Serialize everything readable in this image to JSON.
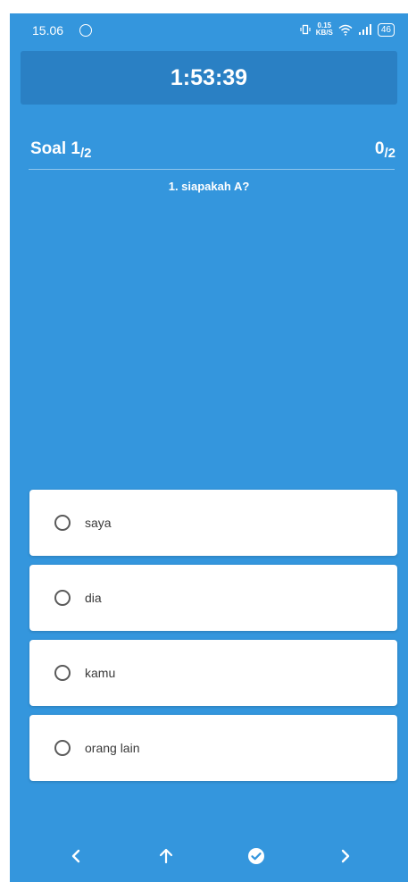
{
  "status_bar": {
    "time": "15.06",
    "speed_value": "0.15",
    "speed_unit": "KB/S",
    "battery": "46"
  },
  "timer": {
    "value": "1:53:39"
  },
  "header": {
    "soal_label": "Soal 1",
    "soal_total": "/2",
    "score": "0",
    "score_total": "/2"
  },
  "question": {
    "text": "1. siapakah A?"
  },
  "options": [
    {
      "label": "saya"
    },
    {
      "label": "dia"
    },
    {
      "label": "kamu"
    },
    {
      "label": "orang lain"
    }
  ],
  "nav": {
    "icons": [
      "chevron-left-icon",
      "arrow-up-icon",
      "check-circle-icon",
      "chevron-right-icon"
    ]
  },
  "colors": {
    "background": "#3496dd",
    "timer_bg": "#2a80c4",
    "card": "#ffffff"
  }
}
